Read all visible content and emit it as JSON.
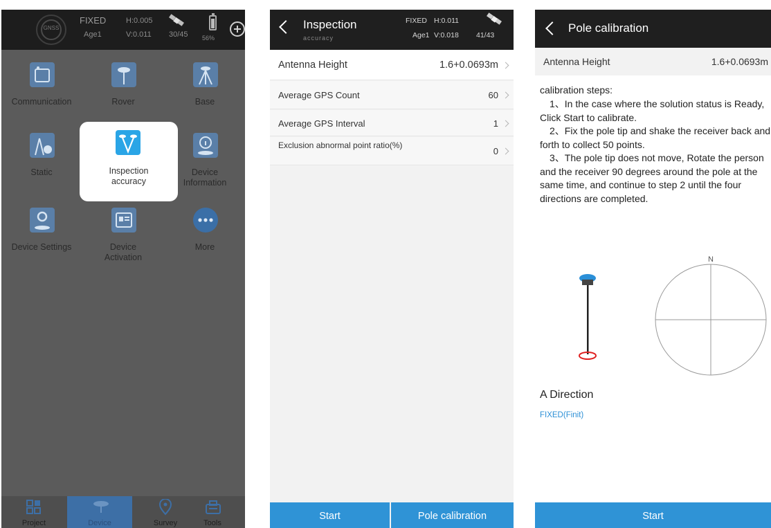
{
  "colors": {
    "accent": "#2f93d6",
    "header": "#1f1f1f",
    "dim_overlay": "#5b5b5b",
    "highlight": "#ffffff"
  },
  "panel1": {
    "status": {
      "dial_label": "GNSS",
      "fix": "FIXED",
      "h": "H:0.005",
      "age": "Age1",
      "v": "V:0.011",
      "sats": "30/45",
      "battery": "56%"
    },
    "tiles": [
      {
        "label": "Communication",
        "icon": "communication-icon"
      },
      {
        "label": "Rover",
        "icon": "rover-icon"
      },
      {
        "label": "Base",
        "icon": "base-icon"
      },
      {
        "label": "Static",
        "icon": "static-icon"
      },
      {
        "label": "Inspection accuracy",
        "icon": "inspection-accuracy-icon"
      },
      {
        "label": "Device Information",
        "icon": "info-icon"
      },
      {
        "label": "Device Settings",
        "icon": "device-settings-icon"
      },
      {
        "label": "Device Activation",
        "icon": "device-activation-icon"
      },
      {
        "label": "More",
        "icon": "more-icon"
      }
    ],
    "tabs": [
      {
        "label": "Project",
        "icon": "project-icon"
      },
      {
        "label": "Device",
        "icon": "device-icon"
      },
      {
        "label": "Survey",
        "icon": "survey-icon"
      },
      {
        "label": "Tools",
        "icon": "tools-icon"
      }
    ]
  },
  "panel2": {
    "title": "Inspection",
    "title_sub": "accuracy",
    "status": {
      "fix": "FIXED",
      "h": "H:0.011",
      "age": "Age1",
      "v": "V:0.018",
      "sats": "41/43"
    },
    "antenna": {
      "label": "Antenna Height",
      "value": "1.6+0.0693m"
    },
    "rows": [
      {
        "label": "Average GPS Count",
        "value": "60"
      },
      {
        "label": "Average GPS Interval",
        "value": "1"
      },
      {
        "label": "Exclusion abnormal point ratio(%)",
        "value": "0"
      }
    ],
    "start_label": "Start",
    "pole_label": "Pole calibration"
  },
  "panel3": {
    "title": "Pole calibration",
    "antenna": {
      "label": "Antenna Height",
      "value": "1.6+0.0693m"
    },
    "steps_title": "calibration steps:",
    "steps": [
      "1、In the case where the solution status is Ready, Click Start to calibrate.",
      "2、Fix the pole tip and shake the receiver back and forth to collect 50 points.",
      "3、The pole tip does not move, Rotate the person and the receiver 90 degrees around the pole at the same time, and continue to step 2 until the four directions are completed."
    ],
    "compass_north": "N",
    "direction": "A Direction",
    "direction_status": "FIXED(Finit)",
    "start_label": "Start"
  }
}
